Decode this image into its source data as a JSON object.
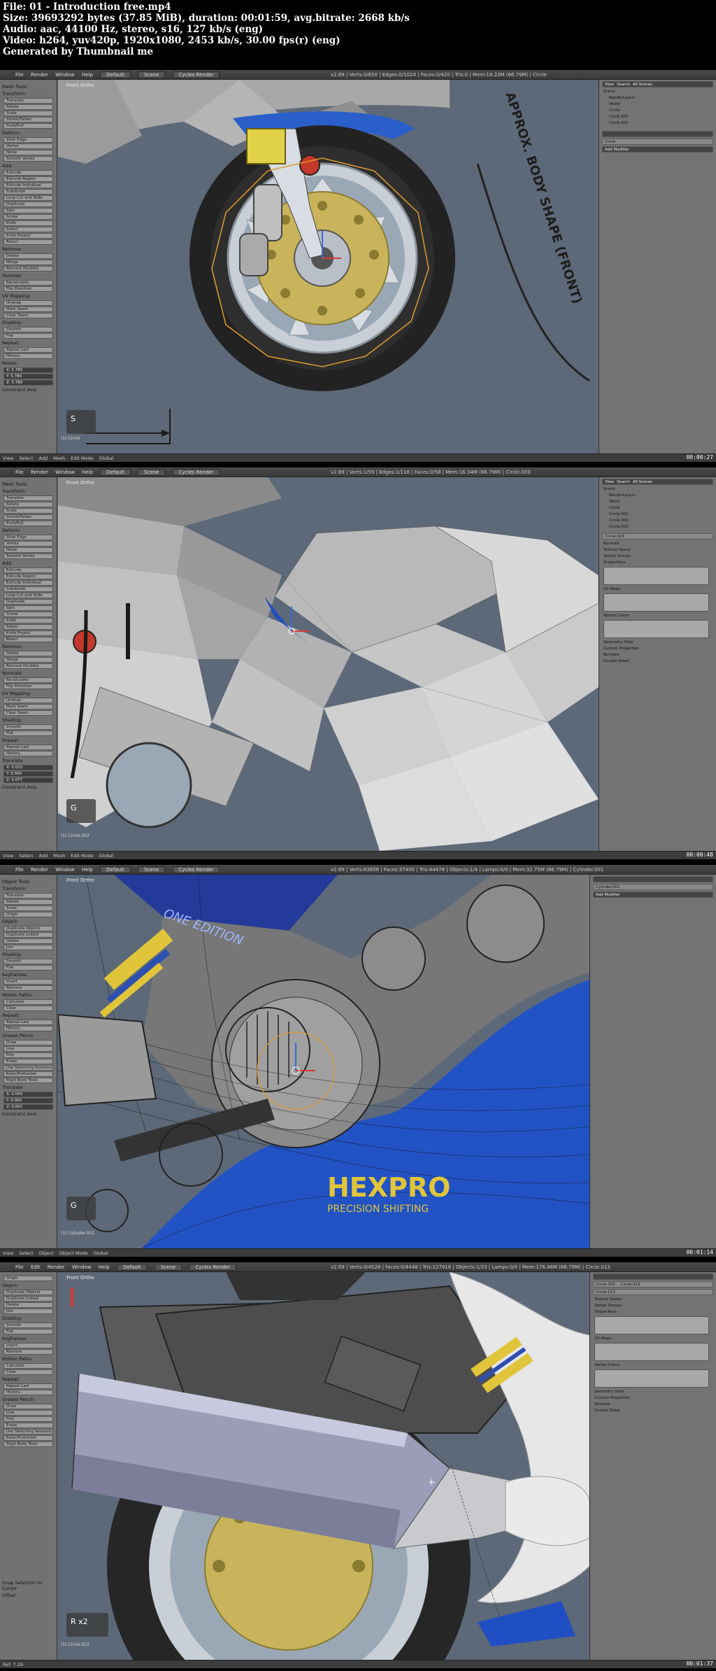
{
  "info": {
    "file": "File: 01 - Introduction free.mp4",
    "size": "Size: 39693292 bytes (37.85 MiB), duration: 00:01:59, avg.bitrate: 2668 kb/s",
    "audio": "Audio: aac, 44100 Hz, stereo, s16, 127 kb/s (eng)",
    "video": "Video: h264, yuv420p, 1920x1080, 2453 kb/s, 30.00 fps(r) (eng)",
    "generated": "Generated by Thumbnail me"
  },
  "frames": [
    {
      "timestamp": "00:00:27",
      "menu": [
        "File",
        "Render",
        "Window",
        "Help"
      ],
      "layout": "Default",
      "scene": "Scene",
      "engine": "Cycles Render",
      "stats": "v2.69 | Verts:0/650 | Edges:0/1024 | Faces:0/420 | Tris:0 | Mem:18.23M (66.79M) | Circle",
      "viewport_label": "Front Ortho",
      "left_panel": {
        "title": "Mesh Tools",
        "items": [
          "Transform:",
          "Translate",
          "Rotate",
          "Scale",
          "Shrink/Fatten",
          "Push/Pull",
          "Deform:",
          "Slide Edge",
          "Vertex",
          "Noise",
          "Smooth Vertex",
          "Add:",
          "Extrude",
          "Extrude Region",
          "Extrude Individual",
          "Subdivide",
          "Loop Cut and Slide",
          "Duplicate",
          "Spin",
          "Screw",
          "Knife",
          "Select",
          "Knife Project",
          "Bisect",
          "Remove:",
          "Delete",
          "Merge",
          "Remove Doubles",
          "Normals:",
          "Recalculate",
          "Flip Direction",
          "UV Mapping:",
          "Unwrap",
          "Mark Seam",
          "Clear Seam",
          "Shading:",
          "Smooth",
          "Flat",
          "Repeat:",
          "Repeat Last",
          "History..."
        ],
        "sub_title": "Resize",
        "fields": [
          "X: 5.789",
          "Y: 5.789",
          "Z: 5.789"
        ],
        "constraint": "Constraint Axis"
      },
      "right_panel": {
        "tabs": [
          "View",
          "Search",
          "All Scenes"
        ],
        "tree": [
          "Scene",
          "RenderLayers",
          "World",
          "Circle",
          "Circle.001",
          "Circle.002"
        ],
        "object": "Circle",
        "modifier": "Add Modifier"
      },
      "overlay_text": "APPROX. BODY SHAPE (FRONT)",
      "key_hint": "S",
      "corner": "(1) Circle",
      "bottom": [
        "View",
        "Select",
        "Add",
        "Mesh",
        "Edit Mode",
        "Global"
      ]
    },
    {
      "timestamp": "00:00:48",
      "menu": [
        "File",
        "Render",
        "Window",
        "Help"
      ],
      "layout": "Default",
      "scene": "Scene",
      "engine": "Cycles Render",
      "stats": "v2.69 | Verts:1/59 | Edges:1/116 | Faces:0/58 | Mem:16.34M (66.79M) | Circle.003",
      "viewport_label": "Front Ortho",
      "left_panel": {
        "title": "Mesh Tools",
        "items": [
          "Transform:",
          "Translate",
          "Rotate",
          "Scale",
          "Shrink/Fatten",
          "Push/Pull",
          "Deform:",
          "Slide Edge",
          "Vertex",
          "Noise",
          "Smooth Vertex",
          "Add:",
          "Extrude",
          "Extrude Region",
          "Extrude Individual",
          "Subdivide",
          "Loop Cut and Slide",
          "Duplicate",
          "Spin",
          "Screw",
          "Knife",
          "Select",
          "Knife Project",
          "Bisect",
          "Remove:",
          "Delete",
          "Merge",
          "Remove Doubles",
          "Normals:",
          "Recalculate",
          "Flip Direction",
          "UV Mapping:",
          "Unwrap",
          "Mark Seam",
          "Clear Seam",
          "Shading:",
          "Smooth",
          "Flat",
          "Repeat:",
          "Repeat Last",
          "History..."
        ],
        "sub_title": "Translate",
        "fields": [
          "X: 0.015",
          "Y: 0.000",
          "Z: 0.077"
        ],
        "constraint": "Constraint Axis"
      },
      "right_panel": {
        "tabs": [
          "View",
          "Search",
          "All Scenes"
        ],
        "tree": [
          "Scene",
          "RenderLayers",
          "World",
          "Circle",
          "Circle.001",
          "Circle.002",
          "Circle.003"
        ],
        "object": "Circle.003",
        "sections": [
          "Normals",
          "Texture Space",
          "Vertex Groups",
          "Shape Keys",
          "UV Maps",
          "Vertex Colors",
          "Geometry Data",
          "Custom Properties",
          "Normals",
          "Double Sided"
        ]
      },
      "key_hint": "G",
      "corner": "(1) Circle.003",
      "bottom": [
        "View",
        "Select",
        "Add",
        "Mesh",
        "Edit Mode",
        "Global"
      ]
    },
    {
      "timestamp": "00:01:14",
      "menu": [
        "File",
        "Render",
        "Window",
        "Help"
      ],
      "layout": "Default",
      "scene": "Scene",
      "engine": "Cycles Render",
      "stats": "v2.69 | Verts:63658 | Faces:37400 | Tris:44478 | Objects:1/4 | Lamps:0/0 | Mem:32.75M (66.79M) | Cylinder.001",
      "viewport_label": "Front Ortho",
      "left_panel": {
        "title": "Object Tools",
        "items": [
          "Transform:",
          "Translate",
          "Rotate",
          "Scale",
          "Origin",
          "Object:",
          "Duplicate Objects",
          "Duplicate Linked",
          "Delete",
          "Join",
          "Shading:",
          "Smooth",
          "Flat",
          "Keyframes:",
          "Insert",
          "Remove",
          "Motion Paths:",
          "Calculate",
          "Clear",
          "Repeat:",
          "Repeat Last",
          "History...",
          "Grease Pencil:",
          "Draw",
          "Line",
          "Poly",
          "Erase",
          "Use Sketching Sessions",
          "Ruler/Protractor",
          "Rigid Body Tools"
        ],
        "sub_title": "Translate",
        "fields": [
          "X: 0.043",
          "Y: 0.000",
          "Z: 0.001"
        ],
        "constraint": "Constraint Axis"
      },
      "right_panel": {
        "object": "Cylinder.001",
        "modifier": "Add Modifier"
      },
      "overlay_text": "HEXPRO",
      "overlay_sub": "PRECISION SHIFTING",
      "overlay_edition": "ONE EDITION",
      "key_hint": "G",
      "corner": "(1) Cylinder.001",
      "bottom": [
        "View",
        "Select",
        "Object",
        "Object Mode",
        "Global"
      ]
    },
    {
      "timestamp": "00:01:37",
      "menu": [
        "File",
        "Edit",
        "Render",
        "Window",
        "Help"
      ],
      "layout": "Default",
      "scene": "Scene",
      "engine": "Cycles Render",
      "stats": "v2.69 | Verts:0/4528 | Faces:0/4448 | Tris:127916 | Objects:1/33 | Lamps:0/0 | Mem:176.46M (66.79M) | Circle.013",
      "viewport_label": "Front Ortho",
      "left_panel": {
        "title": "",
        "items": [
          "Origin",
          "Object:",
          "Duplicate Objects",
          "Duplicate Linked",
          "Delete",
          "Join",
          "Shading:",
          "Smooth",
          "Flat",
          "Keyframes:",
          "Insert",
          "Remove",
          "Motion Paths:",
          "Calculate",
          "Clear",
          "Repeat:",
          "Repeat Last",
          "History...",
          "Grease Pencil:",
          "Draw",
          "Line",
          "Poly",
          "Erase",
          "Use Sketching Sessions",
          "Ruler/Protractor",
          "Rigid Body Tools"
        ],
        "sub_title": "Snap Selection to Cursor",
        "fields": [
          "Offset"
        ],
        "constraint": ""
      },
      "right_panel": {
        "tabs": [
          "Circle.003",
          "Circle.013"
        ],
        "object": "Circle.013",
        "sections": [
          "Texture Space",
          "Vertex Groups",
          "Shape Keys",
          "UV Maps",
          "Vertex Colors",
          "Geometry Data",
          "Custom Properties",
          "Normals",
          "Double Sided"
        ]
      },
      "key_hint": "R x2",
      "corner": "(1) Circle.013",
      "bottom": [
        "Ref: 7.29"
      ]
    }
  ]
}
